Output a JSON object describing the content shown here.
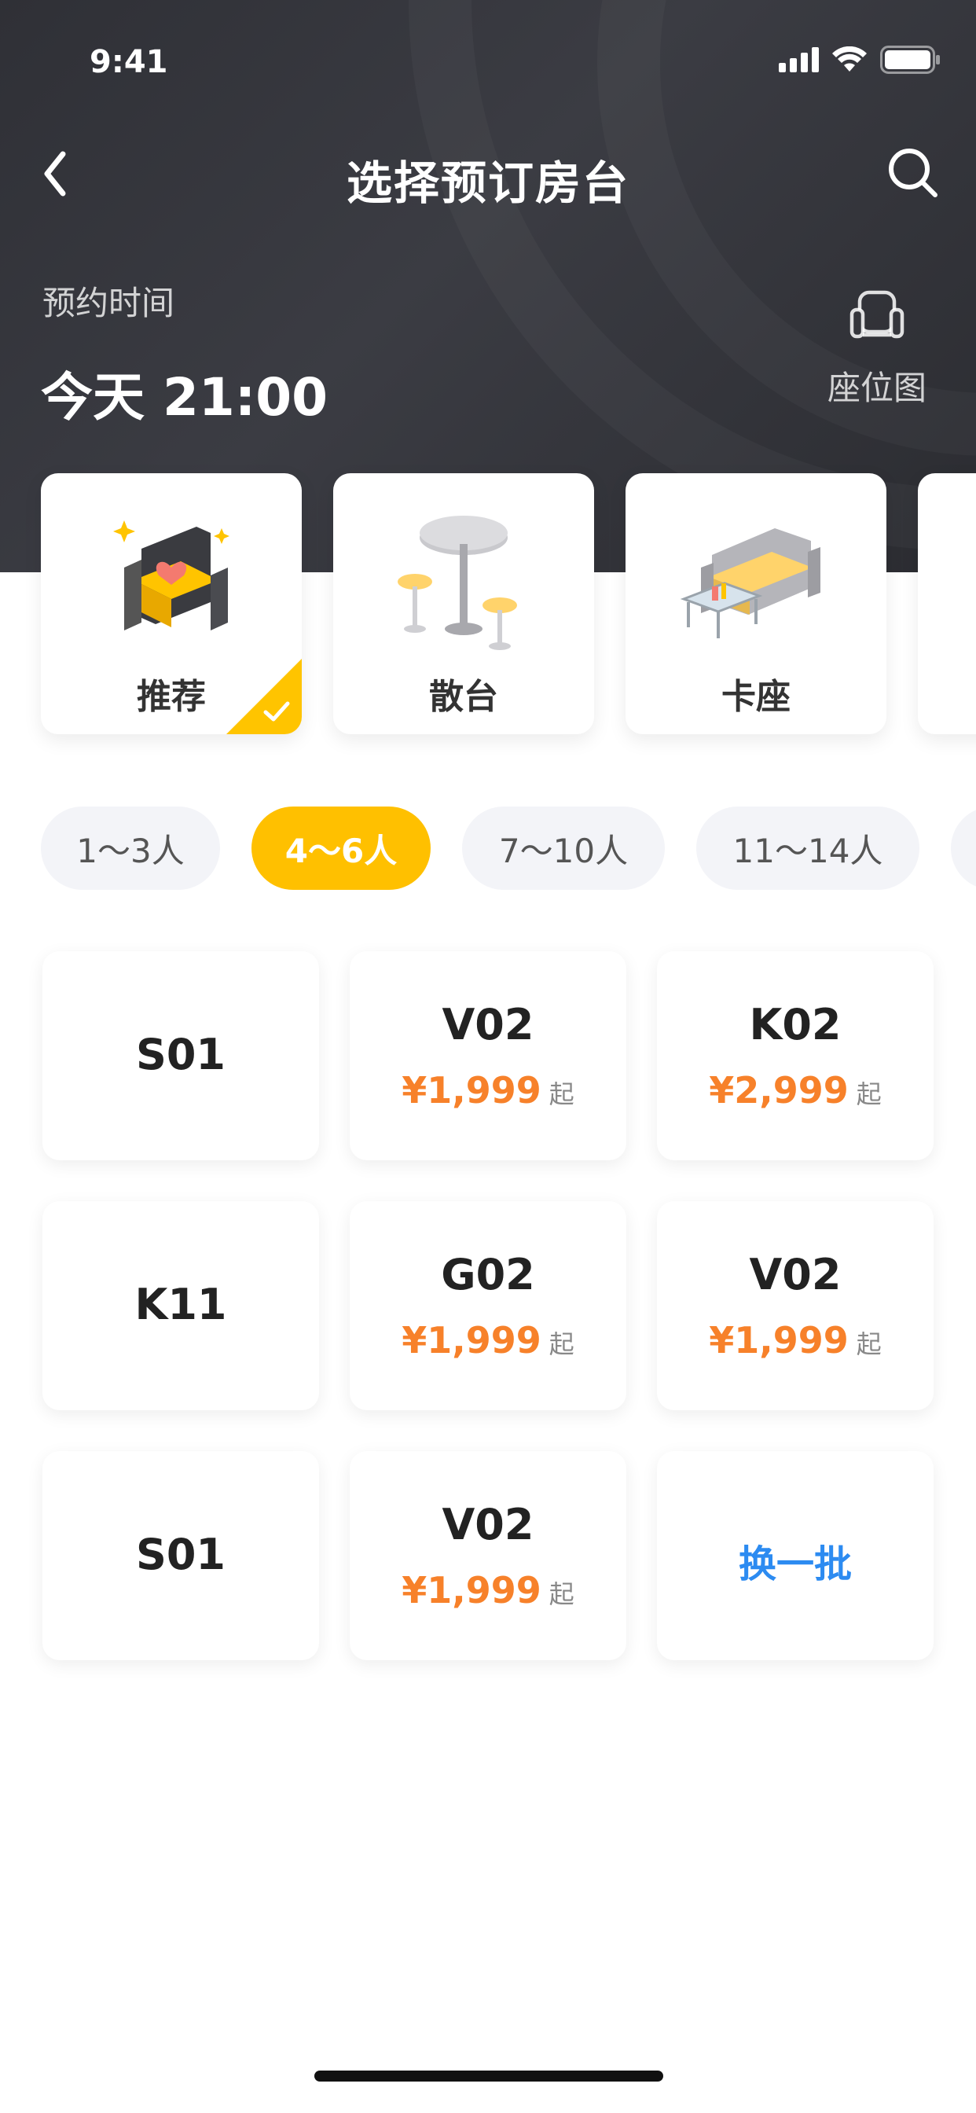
{
  "status_bar": {
    "time": "9:41"
  },
  "nav": {
    "title": "选择预订房台"
  },
  "reservation": {
    "label": "预约时间",
    "value": "今天 21:00",
    "seat_map_label": "座位图"
  },
  "categories": [
    {
      "label": "推荐",
      "selected": true
    },
    {
      "label": "散台",
      "selected": false
    },
    {
      "label": "卡座",
      "selected": false
    }
  ],
  "people_filters": [
    {
      "label": "1～3人",
      "selected": false
    },
    {
      "label": "4～6人",
      "selected": true
    },
    {
      "label": "7～10人",
      "selected": false
    },
    {
      "label": "11～14人",
      "selected": false
    }
  ],
  "tables": [
    {
      "code": "S01"
    },
    {
      "code": "V02",
      "price": "¥1,999",
      "suffix": "起"
    },
    {
      "code": "K02",
      "price": "¥2,999",
      "suffix": "起"
    },
    {
      "code": "K11"
    },
    {
      "code": "G02",
      "price": "¥1,999",
      "suffix": "起"
    },
    {
      "code": "V02",
      "price": "¥1,999",
      "suffix": "起"
    },
    {
      "code": "S01"
    },
    {
      "code": "V02",
      "price": "¥1,999",
      "suffix": "起"
    }
  ],
  "refresh_label": "换一批",
  "colors": {
    "accent": "#ffc000",
    "price": "#f7812a",
    "link": "#2c8bf1",
    "header_bg": "#33343a"
  }
}
